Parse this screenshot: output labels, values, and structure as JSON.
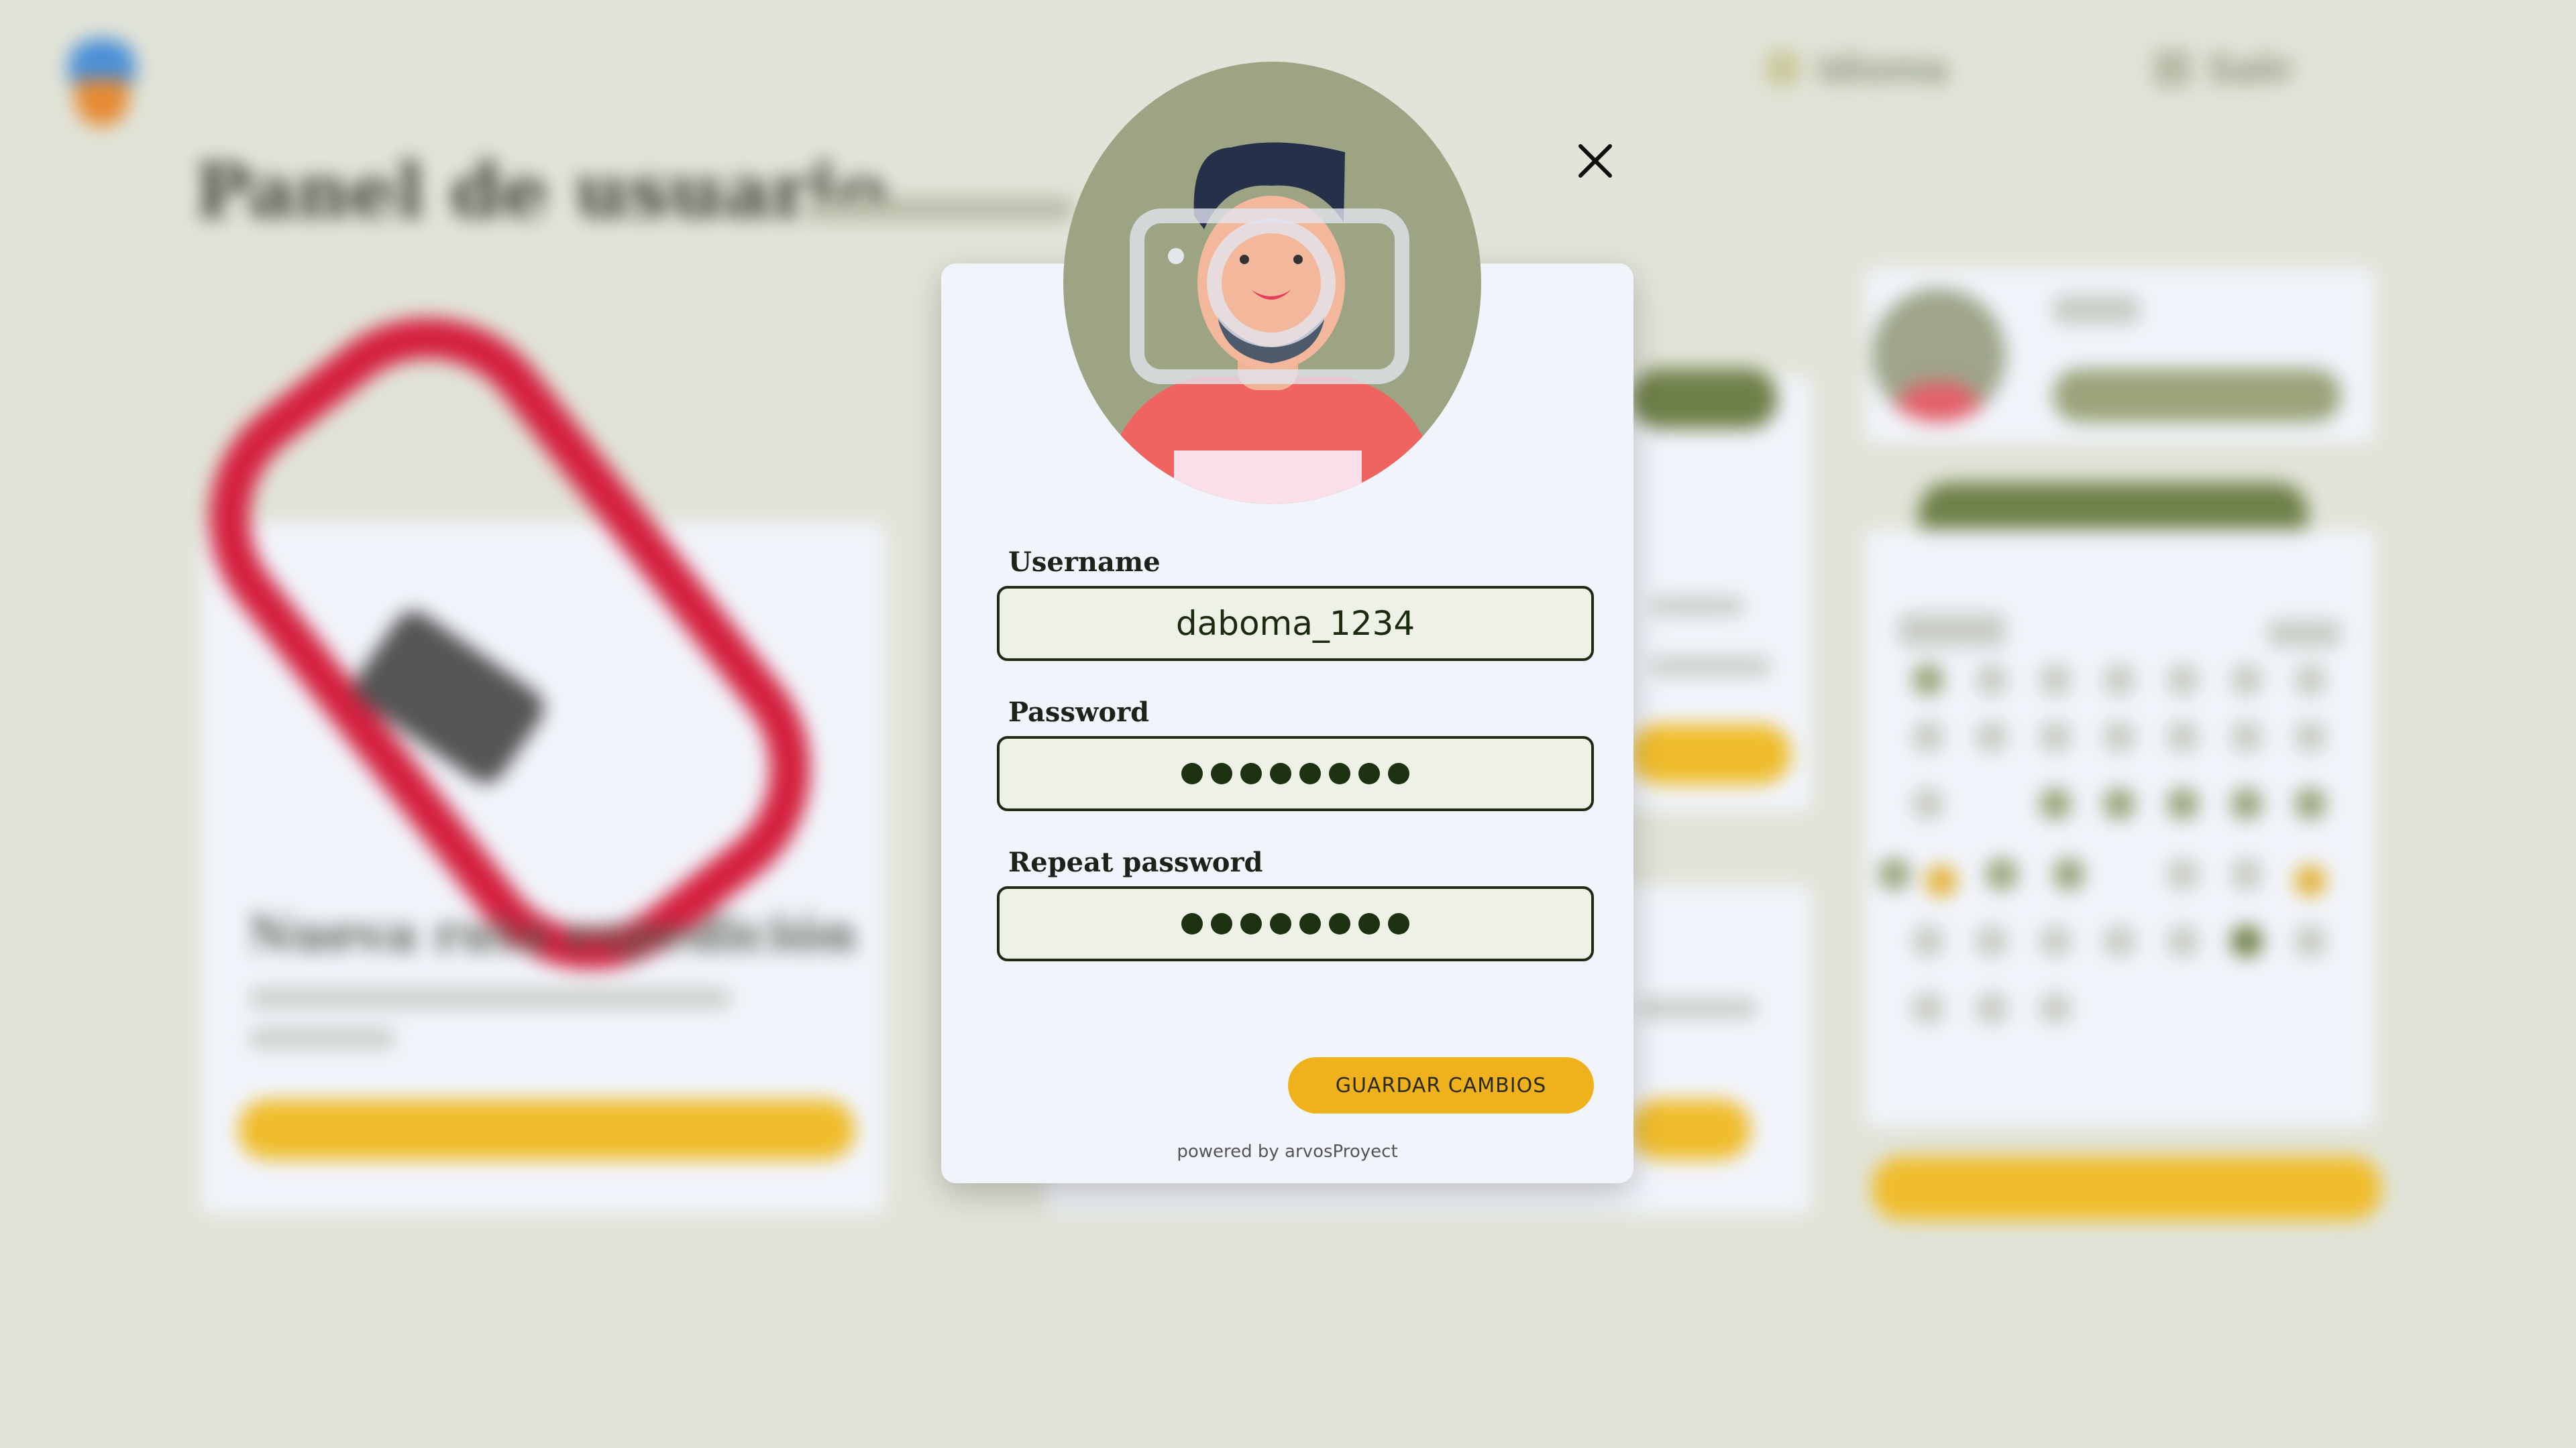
{
  "background": {
    "nav": {
      "item1_label": "Idioma",
      "item2_label": "Salir"
    },
    "page_title": "Panel de usuario",
    "card1_title": "Nueva ruta expedición"
  },
  "modal": {
    "username_label": "Username",
    "username_value": "daboma_1234",
    "password_label": "Password",
    "repeat_password_label": "Repeat password",
    "password_mask_length": 8,
    "save_button": "GUARDAR CAMBIOS",
    "powered_by": "powered by arvosProyect"
  },
  "colors": {
    "accent_yellow": "#efb21d",
    "field_border": "#1f2a15",
    "avatar_bg": "#9da484",
    "shirt": "#e4606a"
  },
  "icons": [
    "close-icon",
    "avatar-camera-icon"
  ]
}
